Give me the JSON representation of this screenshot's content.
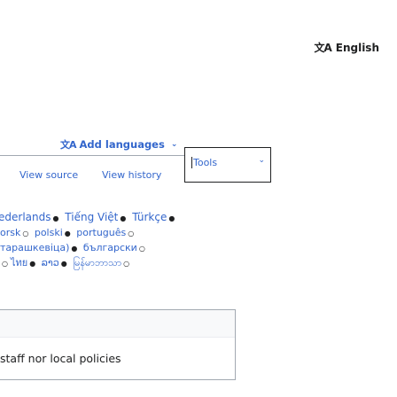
{
  "language_switcher": {
    "icon": "translate-icon",
    "glyph": "文A",
    "label": "English"
  },
  "add_languages": {
    "icon": "translate-icon",
    "glyph": "文A",
    "label": "Add languages",
    "chevron": "⌄"
  },
  "tabs": {
    "view_source": "View source",
    "view_history": "View history",
    "tools": "Tools",
    "tools_chevron": "⌄"
  },
  "languages": [
    [
      {
        "name": "ederlands"
      },
      {
        "name": "Tiếng Việt"
      },
      {
        "name": "Türkçe"
      }
    ],
    [
      {
        "name": "orsk"
      },
      {
        "name": "polski"
      },
      {
        "name": "português"
      }
    ],
    [
      {
        "name": "тарашкевіца)"
      },
      {
        "name": "български"
      }
    ],
    [
      {
        "name": "ไทย"
      },
      {
        "name": "ລາວ"
      },
      {
        "name": "မြန်မာဘာသာ"
      }
    ]
  ],
  "footer_panel": {
    "text": "staff nor local policies"
  }
}
